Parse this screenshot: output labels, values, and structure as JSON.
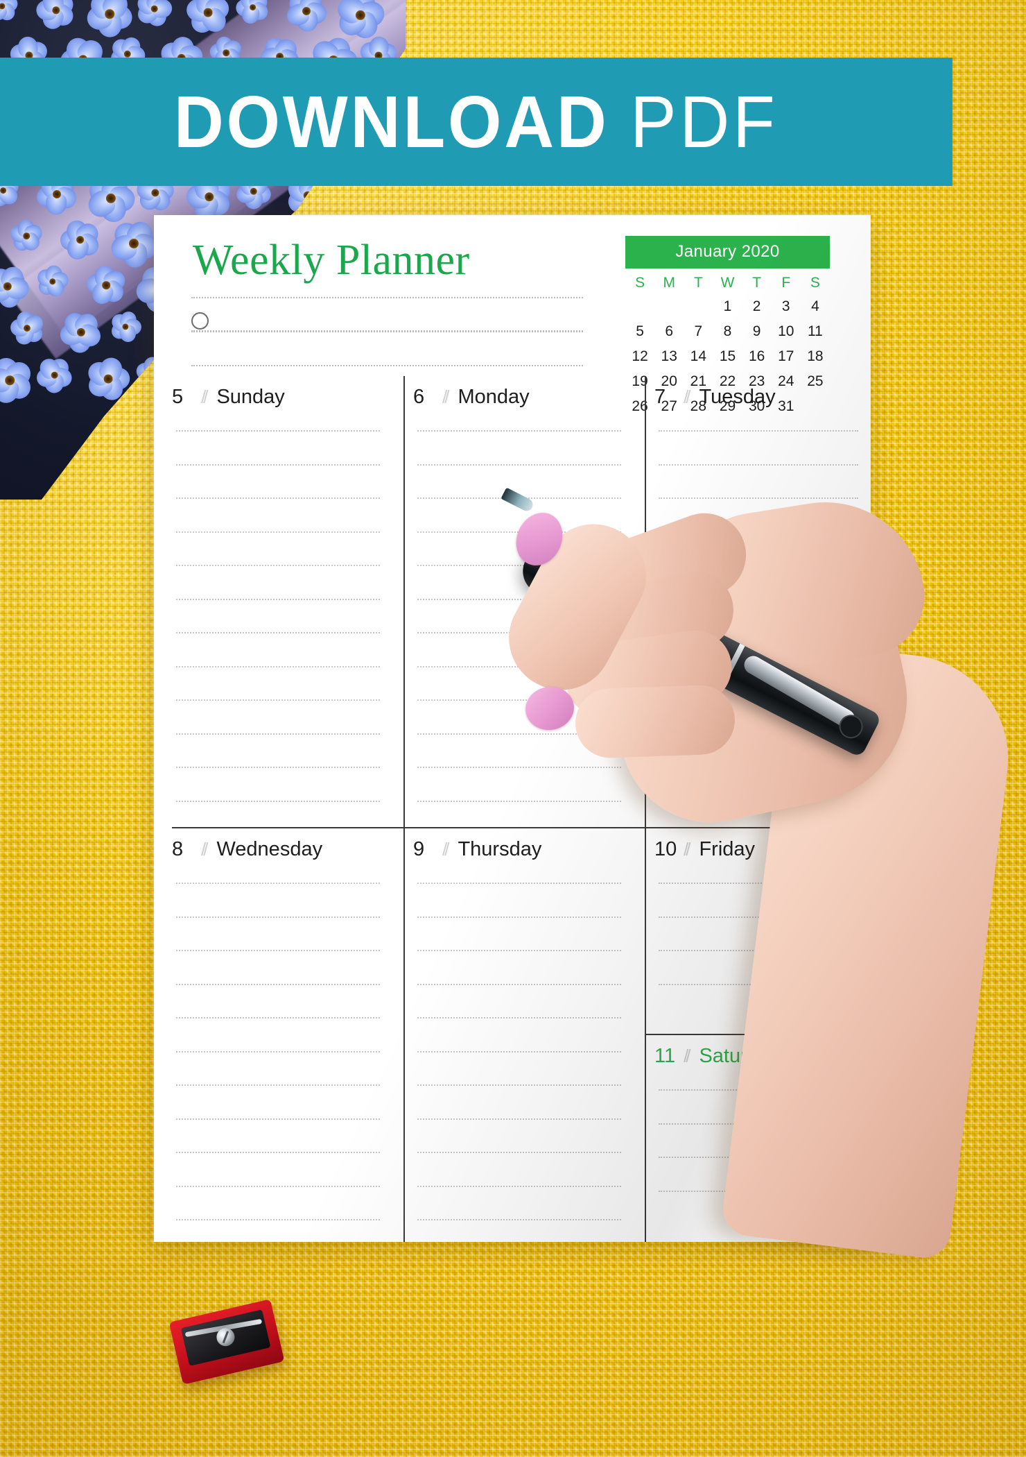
{
  "banner": {
    "bold_word": "DOWNLOAD",
    "thin_word": "PDF",
    "background_color": "#1f9cb4",
    "text_color": "#ffffff"
  },
  "planner": {
    "title": "Weekly Planner",
    "title_color": "#1ba74c",
    "header_note_lines": 4,
    "header_bullet_icon": "circle-bullet-icon",
    "writing_lines_per_day": 12
  },
  "mini_calendar": {
    "month_label": "January 2020",
    "header_color": "#2bb24c",
    "weekday_initials": [
      "S",
      "M",
      "T",
      "W",
      "T",
      "F",
      "S"
    ],
    "leading_blanks": 3,
    "days": [
      1,
      2,
      3,
      4,
      5,
      6,
      7,
      8,
      9,
      10,
      11,
      12,
      13,
      14,
      15,
      16,
      17,
      18,
      19,
      20,
      21,
      22,
      23,
      24,
      25,
      26,
      27,
      28,
      29,
      30,
      31
    ]
  },
  "days": [
    {
      "number": "5",
      "name": "Sunday",
      "separator": "//",
      "weekend": false
    },
    {
      "number": "6",
      "name": "Monday",
      "separator": "//",
      "weekend": false
    },
    {
      "number": "7",
      "name": "Tuesday",
      "separator": "//",
      "weekend": false
    },
    {
      "number": "8",
      "name": "Wednesday",
      "separator": "//",
      "weekend": false
    },
    {
      "number": "9",
      "name": "Thursday",
      "separator": "//",
      "weekend": false
    },
    {
      "number": "10",
      "name": "Friday",
      "separator": "//",
      "weekend": false
    },
    {
      "number": "11",
      "name": "Saturday",
      "separator": "//",
      "weekend": true
    }
  ],
  "objects": {
    "flowers": "forget-me-not-flowers",
    "hand": "writing-hand",
    "pen": "black-ballpoint-pen",
    "sharpener": "red-pencil-sharpener",
    "background": "yellow-knitted-fabric"
  },
  "colors": {
    "teal": "#1f9cb4",
    "green": "#2bb24c",
    "title_green": "#1ba74c",
    "yellow": "#F3C500",
    "page_white": "#ffffff"
  }
}
